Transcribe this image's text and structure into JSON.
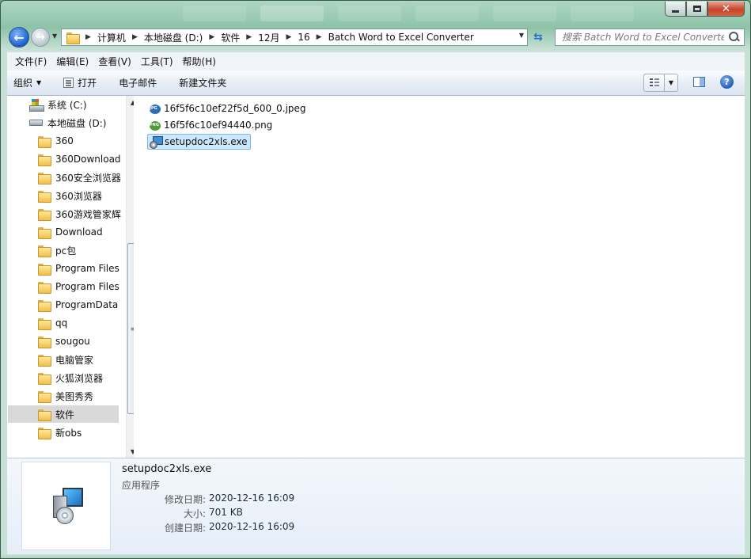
{
  "window": {
    "caption_buttons": {
      "minimize": "minimize",
      "maximize": "maximize",
      "close": "close"
    }
  },
  "nav": {
    "breadcrumb": [
      "计算机",
      "本地磁盘 (D:)",
      "软件",
      "12月",
      "16",
      "Batch Word to Excel Converter"
    ],
    "search_placeholder": "搜索 Batch Word to Excel Converter"
  },
  "menubar": [
    "文件(F)",
    "编辑(E)",
    "查看(V)",
    "工具(T)",
    "帮助(H)"
  ],
  "toolbar": {
    "organize": "组织",
    "open": "打开",
    "email": "电子邮件",
    "new_folder": "新建文件夹"
  },
  "nav_tree": [
    {
      "label": "系统 (C:)",
      "icon": "drive-c-icon"
    },
    {
      "label": "本地磁盘 (D:)",
      "icon": "drive-d-icon"
    },
    {
      "label": "360",
      "icon": "folder-icon"
    },
    {
      "label": "360Download",
      "icon": "folder-icon"
    },
    {
      "label": "360安全浏览器",
      "icon": "folder-icon"
    },
    {
      "label": "360浏览器",
      "icon": "folder-icon"
    },
    {
      "label": "360游戏管家辉",
      "icon": "folder-icon"
    },
    {
      "label": "Download",
      "icon": "folder-icon"
    },
    {
      "label": "pc包",
      "icon": "folder-icon"
    },
    {
      "label": "Program Files",
      "icon": "folder-icon"
    },
    {
      "label": "Program Files",
      "icon": "folder-icon"
    },
    {
      "label": "ProgramData",
      "icon": "folder-icon"
    },
    {
      "label": "qq",
      "icon": "folder-icon"
    },
    {
      "label": "sougou",
      "icon": "folder-icon"
    },
    {
      "label": "电脑管家",
      "icon": "folder-icon"
    },
    {
      "label": "火狐浏览器",
      "icon": "folder-icon"
    },
    {
      "label": "美图秀秀",
      "icon": "folder-icon"
    },
    {
      "label": "软件",
      "icon": "folder-icon",
      "selected": true
    },
    {
      "label": "新obs",
      "icon": "folder-icon"
    }
  ],
  "files": [
    {
      "name": "16f5f6c10ef22f5d_600_0.jpeg",
      "icon": "jpeg-icon"
    },
    {
      "name": "16f5f6c10ef94440.png",
      "icon": "png-icon"
    },
    {
      "name": "setupdoc2xls.exe",
      "icon": "exe-icon",
      "selected": true
    }
  ],
  "details": {
    "name": "setupdoc2xls.exe",
    "type": "应用程序",
    "modified_label": "修改日期:",
    "modified": "2020-12-16 16:09",
    "size_label": "大小:",
    "size": "701 KB",
    "created_label": "创建日期:",
    "created": "2020-12-16 16:09"
  }
}
